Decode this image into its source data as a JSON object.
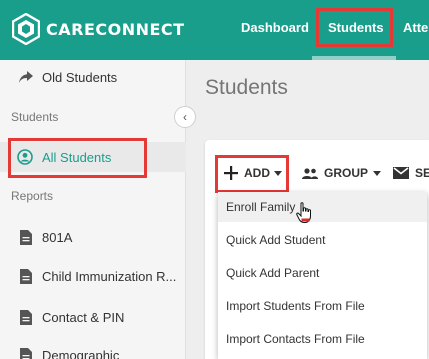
{
  "header": {
    "brand": "CARECONNECT",
    "nav": [
      {
        "label": "Dashboard"
      },
      {
        "label": "Students"
      },
      {
        "label": "Atter"
      }
    ],
    "colors": {
      "primary": "#1a9e8c",
      "highlight": "#e53935"
    }
  },
  "sidebar": {
    "old_students": "Old Students",
    "section_students": "Students",
    "all_students": "All Students",
    "section_reports": "Reports",
    "reports": [
      {
        "label": "801A"
      },
      {
        "label": "Child Immunization R..."
      },
      {
        "label": "Contact & PIN"
      },
      {
        "label": "Demographic"
      }
    ]
  },
  "main": {
    "title": "Students",
    "toolbar": {
      "add_label": "ADD",
      "group_label": "GROUP",
      "send_label": "SE"
    },
    "add_menu": [
      {
        "label": "Enroll Family"
      },
      {
        "label": "Quick Add Student"
      },
      {
        "label": "Quick Add Parent"
      },
      {
        "label": "Import Students From File"
      },
      {
        "label": "Import Contacts From File"
      }
    ]
  }
}
